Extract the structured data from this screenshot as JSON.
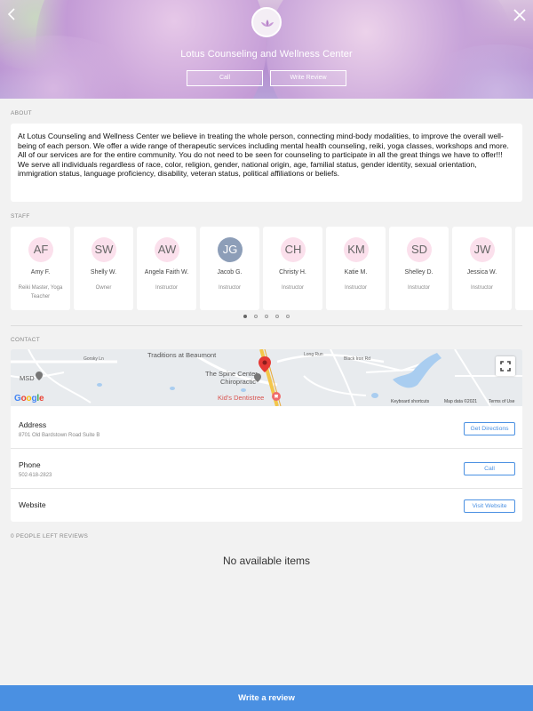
{
  "header": {
    "title": "Lotus Counseling and Wellness Center",
    "call_label": "Call",
    "review_label": "Write Review",
    "back_icon": "chevron-left-icon",
    "close_icon": "close-icon"
  },
  "about": {
    "heading": "ABOUT",
    "text": "At Lotus Counseling and Wellness Center we believe in treating the whole person, connecting mind-body modalities, to improve the overall well-being of each person.  We offer a wide range of therapeutic services including mental health counseling, reiki, yoga classes, workshops and more.  All of our services are for the entire community.  You do not need to be seen for counseling to participate in all the great things we have to offer!!!\nWe serve all individuals regardless of race, color, religion, gender, national origin, age, familial status, gender identity, sexual orientation, immigration status, language proficiency, disability, veteran status, political affiliations or beliefs."
  },
  "staff": {
    "heading": "STAFF",
    "members": [
      {
        "initials": "AF",
        "name": "Amy F.",
        "role": "Reiki Master, Yoga Teacher"
      },
      {
        "initials": "SW",
        "name": "Shelly W.",
        "role": "Owner"
      },
      {
        "initials": "AW",
        "name": "Angela Faith W.",
        "role": "Instructor"
      },
      {
        "initials": "JG",
        "name": "Jacob G.",
        "role": "Instructor"
      },
      {
        "initials": "CH",
        "name": "Christy H.",
        "role": "Instructor"
      },
      {
        "initials": "KM",
        "name": "Katie M.",
        "role": "Instructor"
      },
      {
        "initials": "SD",
        "name": "Shelley D.",
        "role": "Instructor"
      },
      {
        "initials": "JW",
        "name": "Jessica W.",
        "role": "Instructor"
      }
    ],
    "page_count": 5,
    "active_page": 1
  },
  "contact": {
    "heading": "CONTACT",
    "map": {
      "labels": [
        "Traditions at Beaumont",
        "The Spine Center",
        "Chiropractic",
        "Kid's Dentistree",
        "MSD",
        "Long Run",
        "Black Iron Rd",
        "Gorsky Ln"
      ],
      "attribution": [
        "Keyboard shortcuts",
        "Map data ©2021",
        "Terms of Use"
      ],
      "google": "Google"
    },
    "rows": [
      {
        "label": "Address",
        "value": "8701 Old Bardstown Road Suite B",
        "button": "Get Directions"
      },
      {
        "label": "Phone",
        "value": "502-618-2823",
        "button": "Call"
      },
      {
        "label": "Website",
        "value": "",
        "button": "Visit Website"
      }
    ]
  },
  "reviews": {
    "heading": "0 PEOPLE LEFT REVIEWS",
    "empty_text": "No available items"
  },
  "footer": {
    "write_review": "Write a review"
  },
  "colors": {
    "accent": "#4a90e2",
    "avatar_pink": "#fbe0ec",
    "avatar_blue": "#8d9eb8"
  }
}
